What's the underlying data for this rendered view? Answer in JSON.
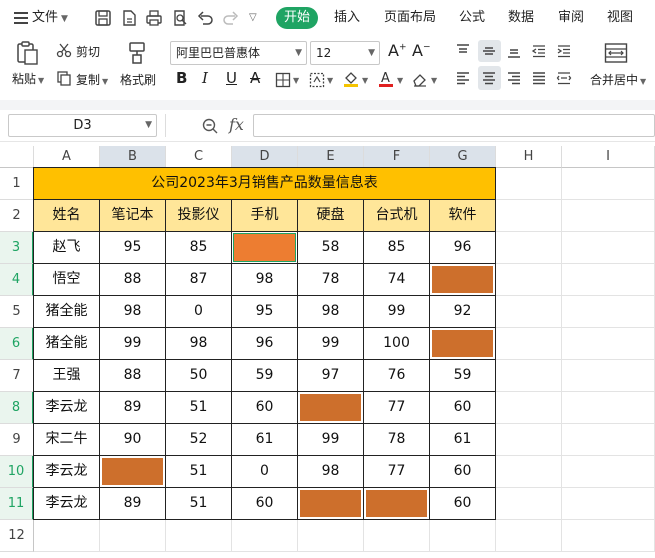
{
  "menubar": {
    "file_label": "文件",
    "tabs": [
      "开始",
      "插入",
      "页面布局",
      "公式",
      "数据",
      "审阅",
      "视图"
    ]
  },
  "ribbon": {
    "paste": "粘贴",
    "cut": "剪切",
    "copy": "复制",
    "format_painter": "格式刷",
    "font_name": "阿里巴巴普惠体",
    "font_size": "12",
    "merge_center": "合并居中"
  },
  "formula_bar": {
    "name_box": "D3",
    "fx": "fx",
    "value": ""
  },
  "colors": {
    "accent": "#1fa463",
    "title_fill": "#ffc000",
    "header_fill": "#ffe699",
    "highlight_fill": "#cd6f2c",
    "selected_fill": "#ed7d31"
  },
  "sheet": {
    "columns": [
      "A",
      "B",
      "C",
      "D",
      "E",
      "F",
      "G",
      "H",
      "I"
    ],
    "row_numbers": [
      "1",
      "2",
      "3",
      "4",
      "5",
      "6",
      "7",
      "8",
      "9",
      "10",
      "11",
      "12"
    ],
    "title": "公司2023年3月销售产品数量信息表",
    "headers": [
      "姓名",
      "笔记本",
      "投影仪",
      "手机",
      "硬盘",
      "台式机",
      "软件"
    ],
    "rows": [
      [
        "赵飞",
        "95",
        "85",
        "",
        "58",
        "85",
        "96"
      ],
      [
        "悟空",
        "88",
        "87",
        "98",
        "78",
        "74",
        ""
      ],
      [
        "猪全能",
        "98",
        "0",
        "95",
        "98",
        "99",
        "92"
      ],
      [
        "猪全能",
        "99",
        "98",
        "96",
        "99",
        "100",
        ""
      ],
      [
        "王强",
        "88",
        "50",
        "59",
        "97",
        "76",
        "59"
      ],
      [
        "李云龙",
        "89",
        "51",
        "60",
        "",
        "77",
        "60"
      ],
      [
        "宋二牛",
        "90",
        "52",
        "61",
        "99",
        "78",
        "61"
      ],
      [
        "李云龙",
        "",
        "51",
        "0",
        "98",
        "77",
        "60"
      ],
      [
        "李云龙",
        "89",
        "51",
        "60",
        "",
        "",
        "60"
      ]
    ],
    "filled_cells": [
      [
        0,
        3
      ],
      [
        1,
        6
      ],
      [
        3,
        6
      ],
      [
        5,
        4
      ],
      [
        7,
        1
      ],
      [
        8,
        4
      ],
      [
        8,
        5
      ]
    ],
    "active_cell": [
      0,
      3
    ]
  }
}
